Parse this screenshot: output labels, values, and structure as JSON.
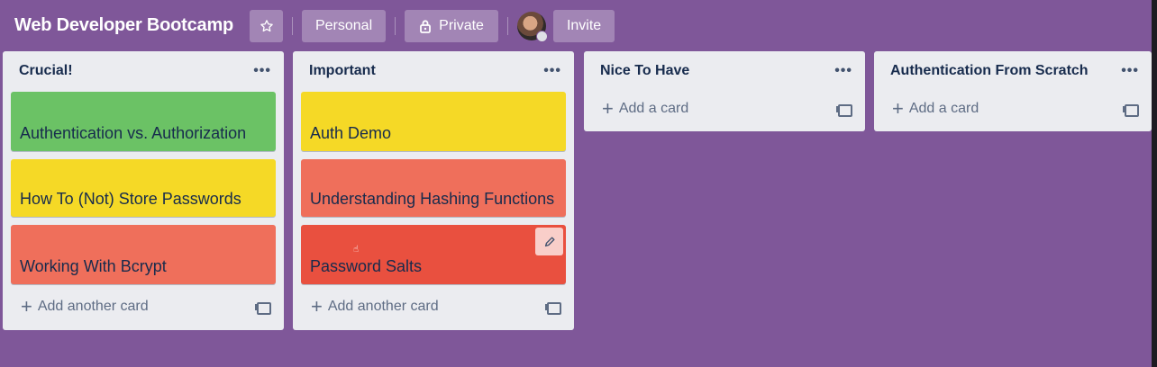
{
  "board": {
    "title": "Web Developer Bootcamp",
    "personal_label": "Personal",
    "private_label": "Private",
    "invite_label": "Invite"
  },
  "lists": [
    {
      "title": "Crucial!",
      "cards": [
        "Authentication vs. Authorization",
        "How To (Not) Store Passwords",
        "Working With Bcrypt"
      ],
      "add_label": "Add another card"
    },
    {
      "title": "Important",
      "cards": [
        "Auth Demo",
        "Understanding Hashing Functions",
        "Password Salts"
      ],
      "add_label": "Add another card"
    },
    {
      "title": "Nice To Have",
      "cards": [],
      "add_label": "Add a card"
    },
    {
      "title": "Authentication From Scratch",
      "cards": [],
      "add_label": "Add a card"
    }
  ],
  "colors": {
    "board_bg": "#7f5799",
    "label_green": "#6bc265",
    "label_yellow": "#f5d926",
    "label_salmon": "#ef6f5b",
    "label_red": "#e9503f"
  }
}
